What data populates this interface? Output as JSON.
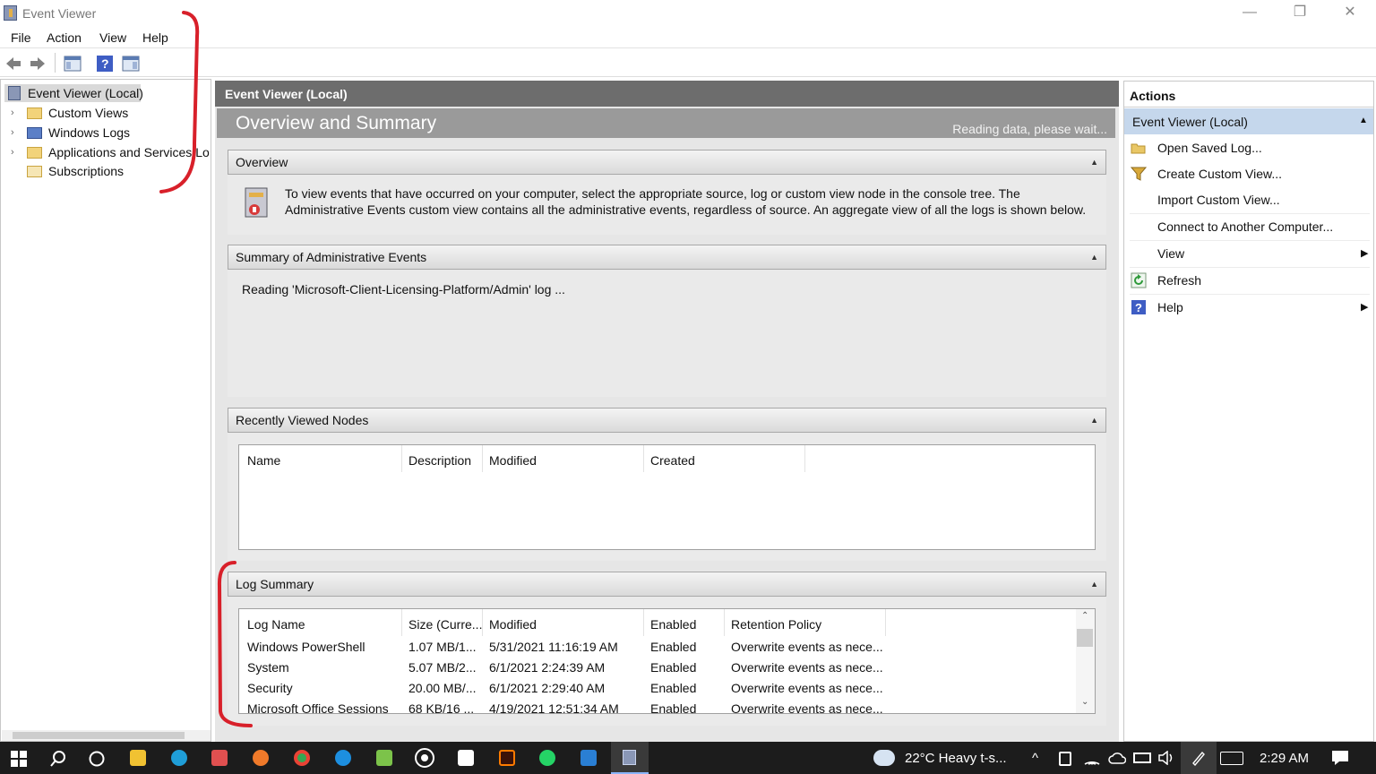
{
  "window": {
    "title": "Event Viewer",
    "controls": {
      "minimize": "—",
      "restore": "❐",
      "close": "✕"
    }
  },
  "menubar": [
    "File",
    "Action",
    "View",
    "Help"
  ],
  "tree": {
    "root": "Event Viewer (Local)",
    "items": [
      "Custom Views",
      "Windows Logs",
      "Applications and Services Log",
      "Subscriptions"
    ]
  },
  "center": {
    "header": "Event Viewer (Local)",
    "title": "Overview and Summary",
    "status": "Reading data, please wait...",
    "overview": {
      "title": "Overview",
      "text": "To view events that have occurred on your computer, select the appropriate source, log or custom view node in the console tree. The Administrative Events custom view contains all the administrative events, regardless of source. An aggregate view of all the logs is shown below."
    },
    "summary": {
      "title": "Summary of Administrative Events",
      "text": "Reading 'Microsoft-Client-Licensing-Platform/Admin' log ..."
    },
    "recent": {
      "title": "Recently Viewed Nodes",
      "columns": [
        "Name",
        "Description",
        "Modified",
        "Created"
      ]
    },
    "log_summary": {
      "title": "Log Summary",
      "columns": [
        "Log Name",
        "Size (Curre...",
        "Modified",
        "Enabled",
        "Retention Policy"
      ],
      "rows": [
        [
          "Windows PowerShell",
          "1.07 MB/1...",
          "5/31/2021 11:16:19 AM",
          "Enabled",
          "Overwrite events as nece..."
        ],
        [
          "System",
          "5.07 MB/2...",
          "6/1/2021 2:24:39 AM",
          "Enabled",
          "Overwrite events as nece..."
        ],
        [
          "Security",
          "20.00 MB/...",
          "6/1/2021 2:29:40 AM",
          "Enabled",
          "Overwrite events as nece..."
        ],
        [
          "Microsoft Office Sessions",
          "68 KB/16 ...",
          "4/19/2021 12:51:34 AM",
          "Enabled",
          "Overwrite events as nece..."
        ]
      ]
    }
  },
  "actions": {
    "header": "Actions",
    "selected": "Event Viewer (Local)",
    "items": [
      "Open Saved Log...",
      "Create Custom View...",
      "Import Custom View...",
      "Connect to Another Computer...",
      "View",
      "Refresh",
      "Help"
    ]
  },
  "taskbar": {
    "weather": "22°C  Heavy t-s...",
    "time": "2:29 AM"
  },
  "colors": {
    "accent": "#c5d7ec",
    "header": "#6d6d6d",
    "annotation": "#d8202a"
  }
}
